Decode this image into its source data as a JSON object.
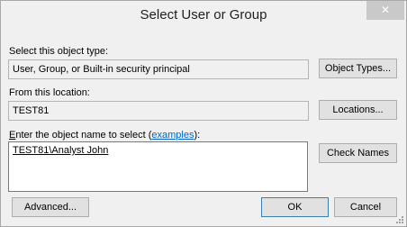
{
  "window": {
    "title": "Select User or Group",
    "close_glyph": "✕"
  },
  "object_type": {
    "label": "Select this object type:",
    "value": "User, Group, or Built-in security principal",
    "button": "Object Types..."
  },
  "location": {
    "label": "From this location:",
    "value": "TEST81",
    "button": "Locations..."
  },
  "object_name": {
    "label_first_letter": "E",
    "label_rest": "nter the object name to select (",
    "label_link": "examples",
    "label_end": "):",
    "entry": "TEST81\\Analyst John",
    "check_names_button": "Check Names"
  },
  "footer": {
    "advanced_button": "Advanced...",
    "ok_button": "OK",
    "cancel_button": "Cancel"
  }
}
